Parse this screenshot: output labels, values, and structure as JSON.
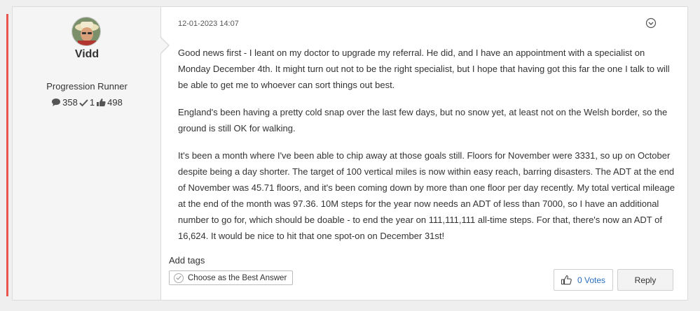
{
  "author": {
    "name": "Vidd",
    "rank": "Progression Runner",
    "stats": {
      "posts": "358",
      "solutions": "1",
      "kudos": "498"
    }
  },
  "post": {
    "date": "12-01-2023 14:07",
    "paragraphs": [
      "Good news first - I leant on my doctor to upgrade my referral.  He did, and I have an appointment with a specialist on Monday December 4th.  It might turn out not to be the right specialist, but I hope that having got this far the one I talk to will be able to get me to whoever can sort things out best.",
      "England's been having a pretty cold snap over the last few days, but no snow yet, at least not on the Welsh border, so the ground is still OK for walking.",
      "It's been a month where I've been able to chip away at those goals still.  Floors for November were 3331, so up on October despite being a day shorter.  The target of 100 vertical miles is now within easy reach, barring disasters.  The ADT at the end of November was 45.71 floors, and it's been coming down by more than one floor per day recently.  My total vertical mileage at the end of the month was 97.36.  10M steps for the year now needs an ADT of less than 7000, so I have an additional number to go for, which should be doable - to end the year on 111,111,111 all-time steps.  For that, there's now an ADT of 16,624.  It would be nice to hit that one spot-on on December 31st!"
    ]
  },
  "actions": {
    "add_tags": "Add tags",
    "best_answer": "Choose as the Best Answer",
    "votes": "0 Votes",
    "reply": "Reply"
  },
  "colors": {
    "accent": "#e8554e",
    "link": "#2a6ebb"
  }
}
